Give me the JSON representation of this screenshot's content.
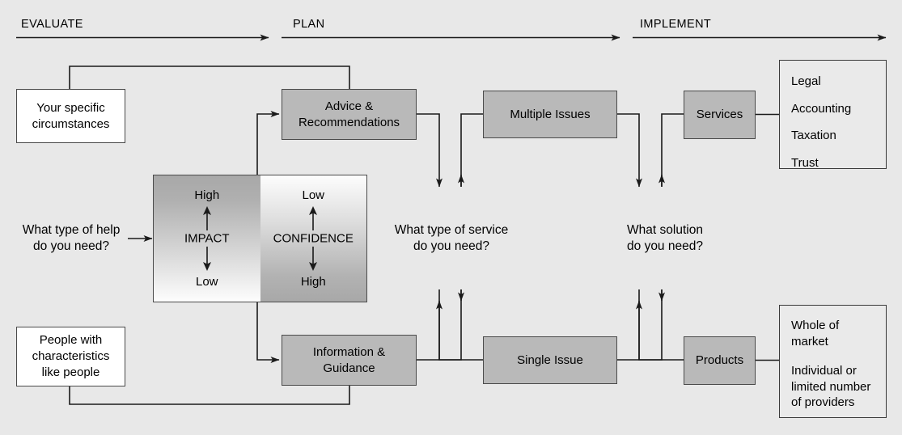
{
  "phases": [
    {
      "label": "EVALUATE"
    },
    {
      "label": "PLAN"
    },
    {
      "label": "IMPLEMENT"
    }
  ],
  "nodes": {
    "your_circumstances": "Your specific\ncircumstances",
    "people_like": "People with\ncharacteristics\nlike people",
    "advice": "Advice &\nRecommendations",
    "information": "Information &\nGuidance",
    "multiple_issues": "Multiple Issues",
    "single_issue": "Single Issue",
    "services": "Services",
    "products": "Products"
  },
  "matrix": {
    "impact": {
      "top": "High",
      "label": "IMPACT",
      "bottom": "Low"
    },
    "confidence": {
      "top": "Low",
      "label": "CONFIDENCE",
      "bottom": "High"
    }
  },
  "questions": {
    "help": [
      "What type of help",
      "do you need?"
    ],
    "service": [
      "What type of service",
      "do you need?"
    ],
    "solution": [
      "What solution",
      "do you need?"
    ]
  },
  "lists": {
    "services": [
      "Legal",
      "Accounting",
      "Taxation",
      "Trust"
    ],
    "products": [
      "Whole of\nmarket",
      "Individual or\nlimited number\nof providers"
    ]
  },
  "colors": {
    "background": "#e8e8e8",
    "box_gray": "#b9b9b9",
    "box_white": "#ffffff",
    "list_box": "#eaeaea",
    "border": "#4a4a4a",
    "line": "#1a1a1a",
    "text": "#000000"
  }
}
